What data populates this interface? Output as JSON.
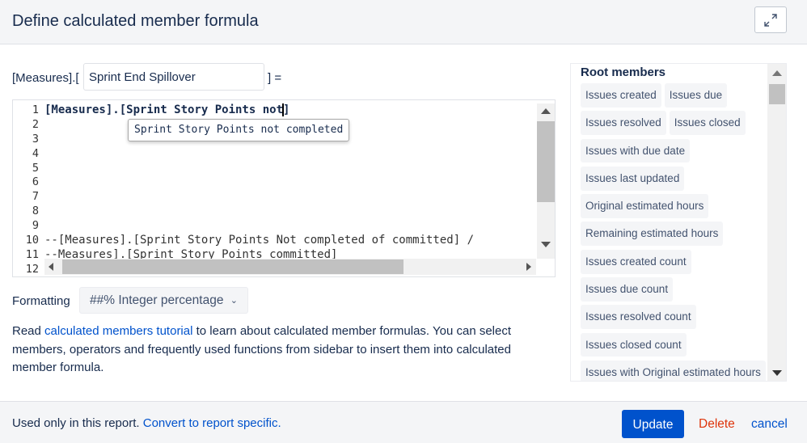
{
  "dialog": {
    "title": "Define calculated member formula",
    "expand_icon": "expand-arrows-icon"
  },
  "name_row": {
    "prefix": "[Measures].[",
    "value": "Sprint End Spillover",
    "suffix": "] ="
  },
  "editor": {
    "line_numbers": [
      "1",
      "2",
      "3",
      "4",
      "5",
      "6",
      "7",
      "8",
      "9",
      "10",
      "11",
      "12"
    ],
    "lines": [
      "[Measures].[Sprint Story Points not",
      "]",
      "",
      "",
      "",
      "",
      "",
      "",
      "",
      "--[Measures].[Sprint Story Points Not completed of committed] /",
      "--Measures].[Sprint Story Points committed]",
      ""
    ],
    "autocomplete_suggestion": "Sprint Story Points not completed"
  },
  "formatting": {
    "label": "Formatting",
    "selected": "##% Integer percentage",
    "chevron_icon": "chevron-down-icon"
  },
  "help": {
    "before": "Read ",
    "link": "calculated members tutorial",
    "after": " to learn about calculated member formulas. You can select members, operators and frequently used functions from sidebar to insert them into calculated member formula."
  },
  "sidebar": {
    "heading": "Root members",
    "rows": [
      [
        "Issues created",
        "Issues due"
      ],
      [
        "Issues resolved",
        "Issues closed"
      ],
      [
        "Issues with due date"
      ],
      [
        "Issues last updated"
      ],
      [
        "Original estimated hours"
      ],
      [
        "Remaining estimated hours"
      ],
      [
        "Issues created count"
      ],
      [
        "Issues due count"
      ],
      [
        "Issues resolved count"
      ],
      [
        "Issues closed count"
      ],
      [
        "Issues with Original estimated hours"
      ]
    ]
  },
  "footer": {
    "note": "Used only in this report. ",
    "note_link": "Convert to report specific.",
    "update_label": "Update",
    "delete_label": "Delete",
    "cancel_label": "cancel"
  },
  "colors": {
    "primary": "#0052cc",
    "danger": "#de350b",
    "text": "#172b4d"
  }
}
